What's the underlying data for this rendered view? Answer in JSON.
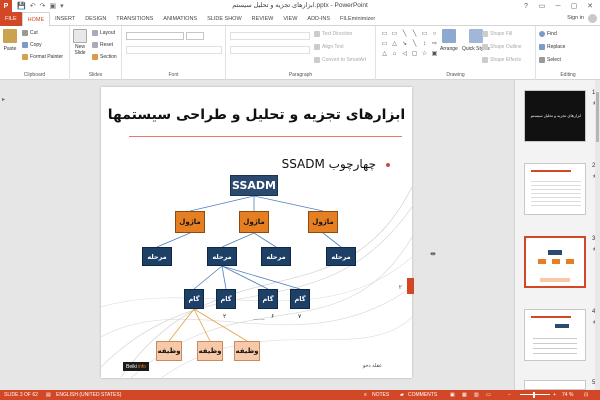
{
  "titlebar": {
    "app_icon": "P",
    "qat": [
      "💾",
      "↶",
      "↷",
      "▣",
      "▾"
    ],
    "title": "ابزارهای تجزیه و تحلیل سیستم.pptx - PowerPoint",
    "controls": [
      "?",
      "▭",
      "─",
      "▢",
      "✕"
    ]
  },
  "tabs": [
    "FILE",
    "HOME",
    "INSERT",
    "DESIGN",
    "TRANSITIONS",
    "ANIMATIONS",
    "SLIDE SHOW",
    "REVIEW",
    "VIEW",
    "ADD-INS",
    "FILEminimizer"
  ],
  "signin": "Sign in",
  "ribbon": {
    "clipboard": {
      "paste": "Paste",
      "cut": "Cut",
      "copy": "Copy",
      "format_painter": "Format Painter",
      "label": "Clipboard"
    },
    "slides": {
      "new_slide": "New",
      "new_slide2": "Slide",
      "layout": "Layout",
      "reset": "Reset",
      "section": "Section",
      "label": "Slides"
    },
    "font": {
      "label": "Font"
    },
    "paragraph": {
      "text_direction": "Text Direction",
      "align_text": "Align Text",
      "convert": "Convert to SmartArt",
      "label": "Paragraph"
    },
    "drawing": {
      "arrange": "Arrange",
      "quick_styles": "Quick Styles",
      "shape_fill": "Shape Fill",
      "shape_outline": "Shape Outline",
      "shape_effects": "Shape Effects",
      "label": "Drawing",
      "shape_glyphs": [
        "▭",
        "▭",
        "╲",
        "╲",
        "▭",
        "○",
        "▭",
        "△",
        "↘",
        "╲",
        "↕",
        "⇨",
        "△",
        "⌂",
        "◁",
        "▢",
        "☆",
        "▣"
      ]
    },
    "editing": {
      "find": "Find",
      "replace": "Replace",
      "select": "Select",
      "label": "Editing"
    }
  },
  "slide": {
    "title": "ابزارهای تجزیه و تحلیل و طراحی سیستمها",
    "bullet": "چهارچوب SSADM",
    "root": "SSADM",
    "modules": [
      "ماژول",
      "ماژول",
      "ماژول"
    ],
    "stages": [
      "مرحله",
      "مرحله",
      "مرحله",
      "مرحله"
    ],
    "steps": [
      "گام",
      "گام",
      "گام",
      "گام"
    ],
    "step_labels": [
      "۲",
      "۶",
      "۷",
      "……"
    ],
    "tasks": [
      "وظیفه",
      "وظیفه",
      "وظیفه"
    ],
    "footer": "عقله دخو",
    "brand1": "Beiki",
    "brand2": "info",
    "page_no": "۲"
  },
  "thumbnails": [
    {
      "num": "1",
      "caption": "ابزارهای تجزیه و تحلیل سیستم"
    },
    {
      "num": "2",
      "caption": ""
    },
    {
      "num": "3",
      "caption": ""
    },
    {
      "num": "4",
      "caption": ""
    },
    {
      "num": "5",
      "caption": ""
    }
  ],
  "status": {
    "slide_of": "SLIDE 3 OF 62",
    "language": "ENGLISH (UNITED STATES)",
    "notes": "NOTES",
    "comments": "COMMENTS",
    "zoom": "74 %"
  },
  "colors": {
    "accent": "#d24726",
    "root": "#2b4a6f",
    "module": "#e67e22",
    "dark": "#1e3f66",
    "task": "#f8c9a8"
  }
}
